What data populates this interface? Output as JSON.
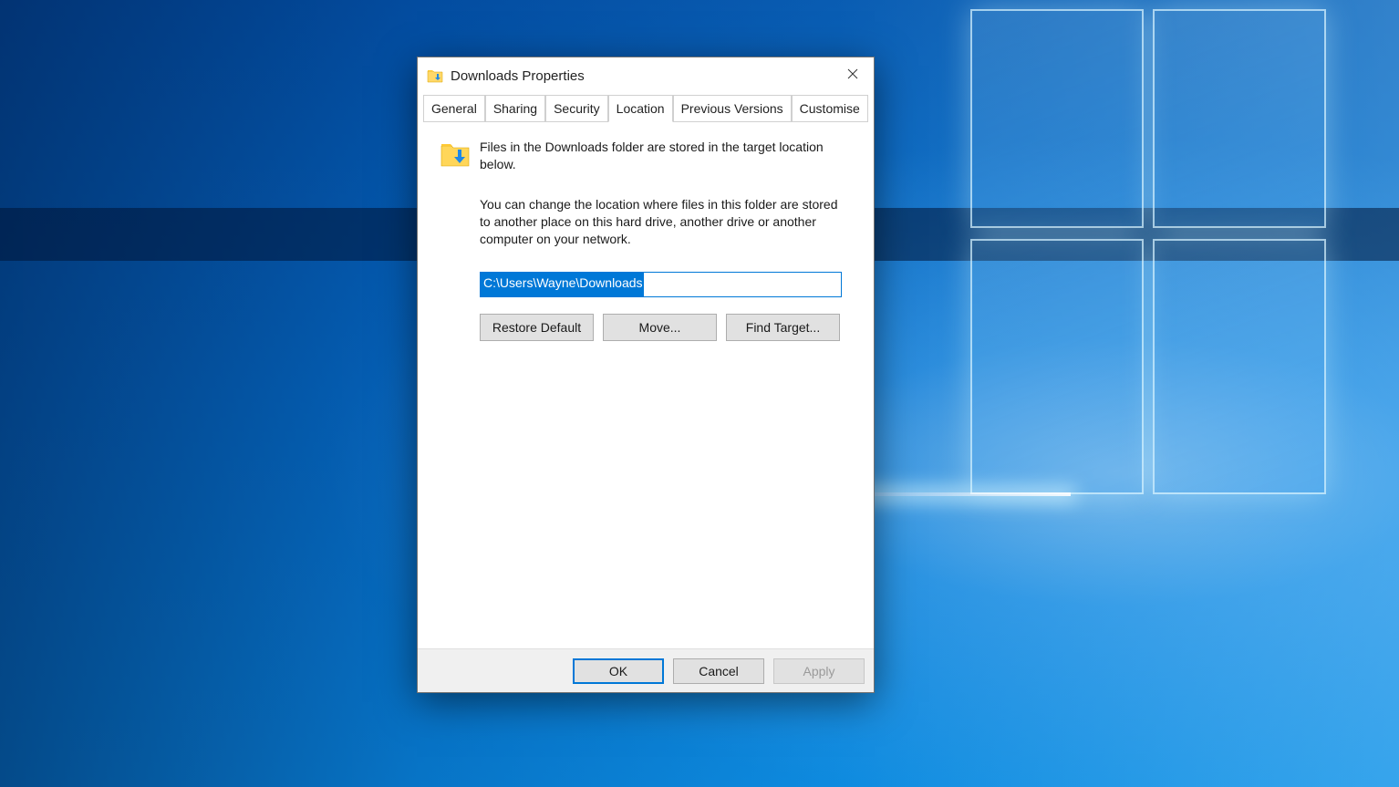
{
  "window": {
    "title": "Downloads Properties"
  },
  "tabs": {
    "general": "General",
    "sharing": "Sharing",
    "security": "Security",
    "location": "Location",
    "previous_versions": "Previous Versions",
    "customise": "Customise",
    "active": "Location"
  },
  "location_tab": {
    "intro": "Files in the Downloads folder are stored in the target location below.",
    "description": "You can change the location where files in this folder are stored to another place on this hard drive, another drive or another computer on your network.",
    "path_value": "C:\\Users\\Wayne\\Downloads",
    "restore_default": "Restore Default",
    "move": "Move...",
    "find_target": "Find Target..."
  },
  "footer": {
    "ok": "OK",
    "cancel": "Cancel",
    "apply": "Apply"
  }
}
